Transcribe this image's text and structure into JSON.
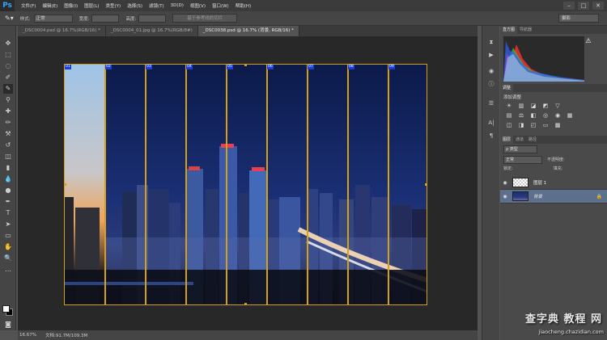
{
  "app": {
    "logo": "Ps"
  },
  "menu": [
    "文件(F)",
    "编辑(E)",
    "图像(I)",
    "图层(L)",
    "类型(Y)",
    "选择(S)",
    "滤镜(T)",
    "3D(D)",
    "视图(V)",
    "窗口(W)",
    "帮助(H)"
  ],
  "window_controls": [
    "–",
    "□",
    "✕"
  ],
  "options": {
    "style_label": "样式:",
    "style_value": "正常",
    "width_label": "宽度:",
    "height_label": "高度:",
    "slice_button": "基于参考线的切片",
    "workspace": "摄影"
  },
  "tabs": [
    "_DSC0004.psd @ 16.7%(RGB/16) *",
    "_DSC0004_01.jpg @ 16.7%(RGB/8#)",
    "_DSC0038.psd @ 16.7% (背景, RGB/16) *"
  ],
  "slices": [
    "01",
    "02",
    "03",
    "04",
    "05",
    "06",
    "07",
    "08",
    "09"
  ],
  "status": {
    "zoom": "16.67%",
    "doc": "文档:91.7M/109.3M"
  },
  "panels": {
    "histogram_tab": "直方图",
    "navigator_tab": "导航器",
    "adjustments_tab": "调整",
    "adjustments_title": "添加调整",
    "layers_tab": "图层",
    "channels_tab": "通道",
    "paths_tab": "路径",
    "kind_filter": "ρ 类型",
    "blend_mode": "正常",
    "opacity_label": "不透明度:",
    "lock_label": "锁定:",
    "fill_label": "填充:",
    "layers": [
      {
        "name": "图层 1",
        "selected": false
      },
      {
        "name": "背景",
        "selected": true
      }
    ]
  },
  "watermark": {
    "top": "查字典 教程 网",
    "bottom": "jiaocheng.chazidian.com"
  }
}
